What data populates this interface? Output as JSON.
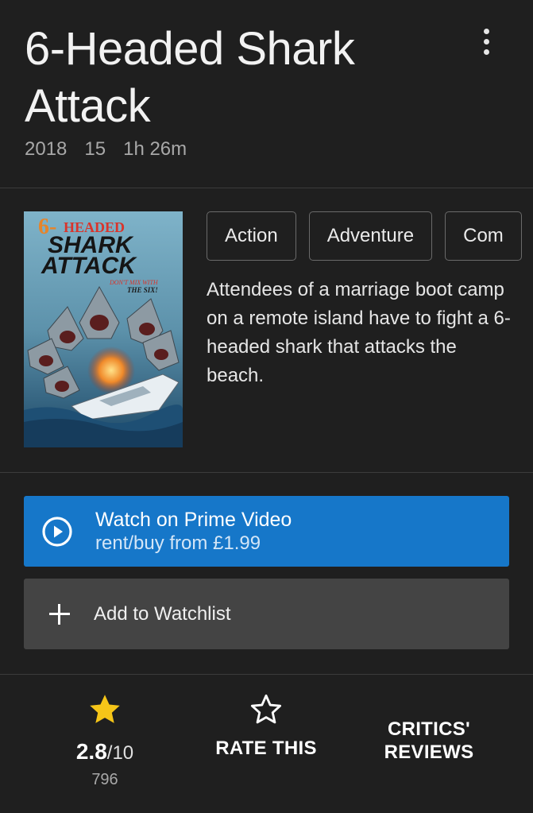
{
  "movie": {
    "title": "6-Headed Shark Attack",
    "year": "2018",
    "certificate": "15",
    "runtime": "1h 26m",
    "genres": [
      "Action",
      "Adventure",
      "Com"
    ],
    "description": "Attendees of a marriage boot camp on a remote island have to fight a 6-headed shark that attacks the beach."
  },
  "poster": {
    "title_prefix": "6-",
    "title_line1": "HEADED",
    "title_line2": "SHARK",
    "title_line3": "ATTACK",
    "tagline_line1": "DON'T MIX WITH",
    "tagline_line2": "THE SIX!"
  },
  "actions": {
    "watch_title": "Watch on Prime Video",
    "watch_subtitle": "rent/buy from £1.99",
    "watchlist_label": "Add to Watchlist"
  },
  "rating": {
    "value": "2.8",
    "out_of": "/10",
    "count": "796",
    "rate_label": "RATE THIS",
    "critics_line1": "CRITICS'",
    "critics_line2": "REVIEWS"
  },
  "colors": {
    "background": "#1f1f1f",
    "accent_blue": "#1677c9",
    "star_yellow": "#f5c518"
  },
  "icons": [
    "more-vert-icon",
    "play-circle-icon",
    "plus-icon",
    "star-filled-icon",
    "star-outline-icon"
  ]
}
